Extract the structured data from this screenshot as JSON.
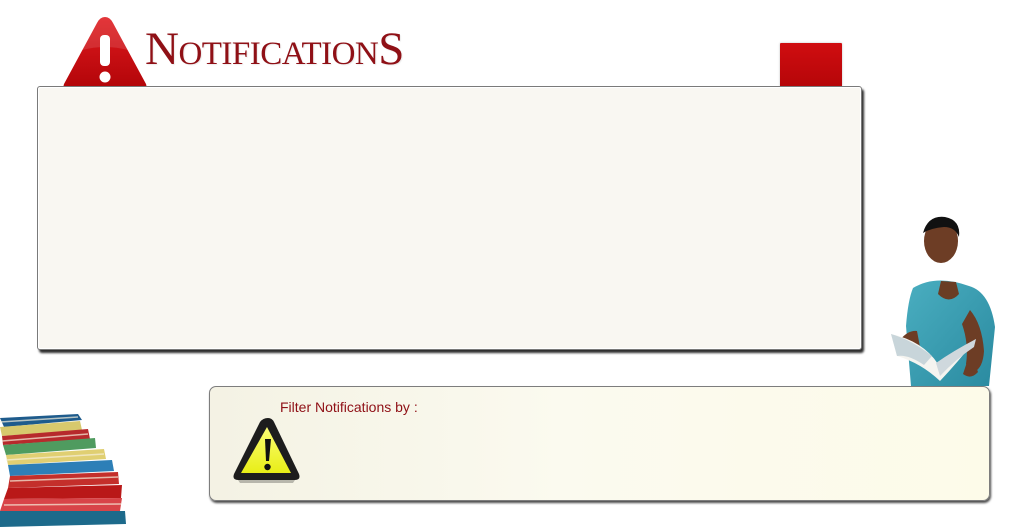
{
  "header": {
    "title": "NotificationS"
  },
  "filter": {
    "label": "Filter Notifications by :"
  },
  "icons": {
    "header_icon": "warning-exclamation-icon",
    "filter_icon": "caution-triangle-icon"
  },
  "colors": {
    "accent_red": "#c8070b",
    "title_red": "#8f1016",
    "panel_bg": "#f9f7f2",
    "filter_bg": "#fbfaef",
    "caution_yellow": "#f1f52a"
  }
}
